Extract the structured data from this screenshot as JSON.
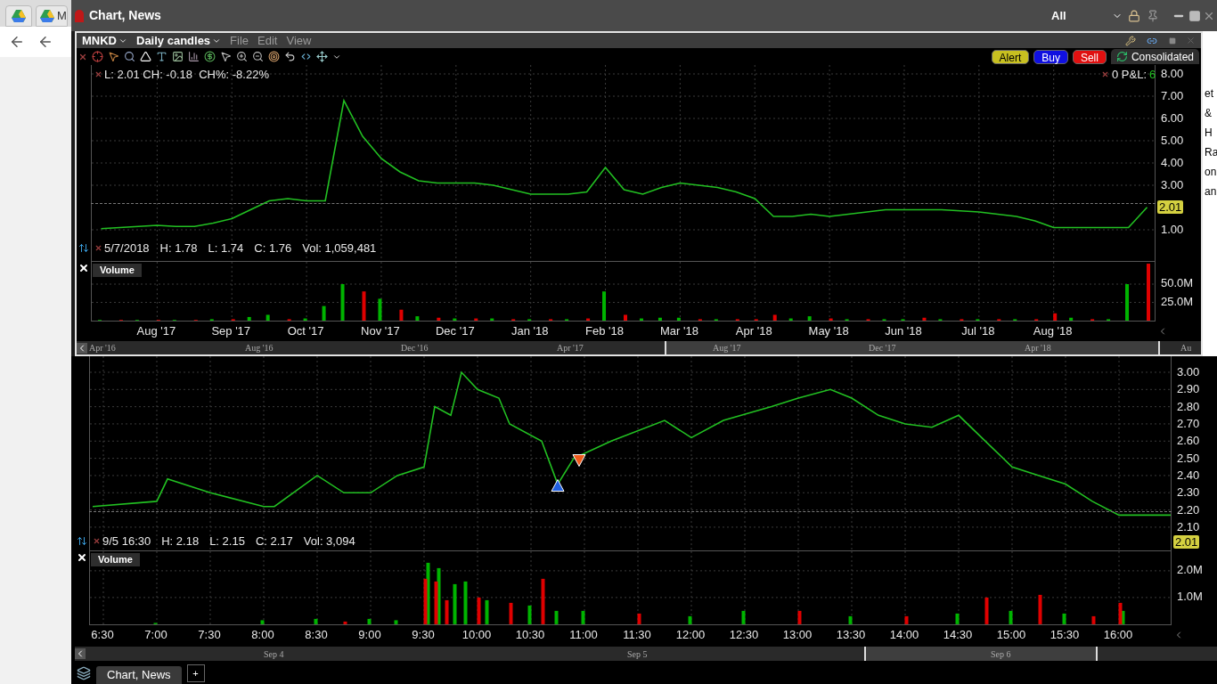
{
  "browser": {
    "tab_text": "M"
  },
  "window": {
    "title": "Chart, News",
    "group_filter": "All"
  },
  "background_fragments": [
    "et",
    "&",
    "H",
    "Ra",
    "on",
    "an"
  ],
  "daily_chart": {
    "symbol": "MNKD",
    "period": "Daily candles",
    "menu": [
      "File",
      "Edit",
      "View"
    ],
    "buttons": [
      {
        "kind": "alert",
        "label": "Alert"
      },
      {
        "kind": "buy",
        "label": "Buy"
      },
      {
        "kind": "sell",
        "label": "Sell"
      }
    ],
    "data_source": "Consolidated",
    "quote": "L: 2.01 CH: -0.18  CH%: -8.22%",
    "position": {
      "label": "0 P&L:",
      "value": "6"
    },
    "bar_info": [
      "5/7/2018",
      "H: 1.78",
      "L: 1.74",
      "C: 1.76",
      "Vol: 1,059,481"
    ],
    "last_price": "2.01",
    "price_chart": {
      "chart_data": {
        "type": "line",
        "grid": true,
        "ylim": [
          -0.4,
          8.4
        ],
        "yticks": [
          {
            "value": 8,
            "label": "8.00"
          },
          {
            "value": 7,
            "label": "7.00"
          },
          {
            "value": 6,
            "label": "6.00"
          },
          {
            "value": 5,
            "label": "5.00"
          },
          {
            "value": 4,
            "label": "4.00"
          },
          {
            "value": 3,
            "label": "3.00"
          },
          {
            "value": 1,
            "label": "1.00"
          }
        ],
        "series": [
          {
            "color": "#22c022",
            "values": [
              1.05,
              1.1,
              1.15,
              1.2,
              1.15,
              1.15,
              1.3,
              1.5,
              1.9,
              2.3,
              2.4,
              2.3,
              2.3,
              6.8,
              5.2,
              4.2,
              3.6,
              3.2,
              3.1,
              3.1,
              3.1,
              3.0,
              2.8,
              2.6,
              2.6,
              2.6,
              2.7,
              3.8,
              2.8,
              2.6,
              2.9,
              3.1,
              3.0,
              2.9,
              2.7,
              2.4,
              1.6,
              1.6,
              1.7,
              1.6,
              1.7,
              1.8,
              1.9,
              1.9,
              1.9,
              1.9,
              1.85,
              1.8,
              1.7,
              1.6,
              1.4,
              1.1,
              1.1,
              1.1,
              1.1,
              1.1,
              2.01
            ]
          }
        ]
      }
    },
    "volume_label": "Volume",
    "volume_chart": {
      "chart_data": {
        "type": "bar",
        "stacked": false,
        "grid": true,
        "ylim": [
          -2.4,
          80.5
        ],
        "categories": [
          null,
          null,
          null,
          "Aug '17",
          null,
          null,
          null,
          "Sep '17",
          null,
          null,
          null,
          "Oct '17",
          null,
          null,
          null,
          "Nov '17",
          null,
          null,
          null,
          "Dec '17",
          null,
          null,
          null,
          "Jan '18",
          null,
          null,
          null,
          "Feb '18",
          null,
          null,
          null,
          "Mar '18",
          null,
          null,
          null,
          "Apr '18",
          null,
          null,
          null,
          "May '18",
          null,
          null,
          null,
          "Jun '18",
          null,
          null,
          null,
          "Jul '18",
          null,
          null,
          null,
          "Aug '18",
          null,
          null,
          null,
          null,
          null
        ],
        "yticks": [
          {
            "value": 50,
            "label": "50.0M"
          },
          {
            "value": 25,
            "label": "25.0M"
          }
        ],
        "series": [
          {
            "color": "#00b400",
            "values": [
              1,
              0,
              1,
              0,
              1,
              0,
              2,
              0,
              5,
              8,
              0,
              3,
              20,
              50,
              0,
              30,
              0,
              6,
              0,
              3,
              0,
              3,
              0,
              2,
              0,
              2,
              0,
              40,
              0,
              3,
              4,
              4,
              0,
              2,
              0,
              0,
              0,
              3,
              6,
              0,
              2,
              0,
              2,
              2,
              0,
              2,
              0,
              2,
              0,
              2,
              0,
              0,
              4,
              0,
              2,
              50,
              0
            ]
          },
          {
            "color": "#e00000",
            "values": [
              0,
              1,
              0,
              1,
              0,
              1,
              0,
              2,
              0,
              0,
              2,
              0,
              0,
              0,
              40,
              0,
              15,
              0,
              4,
              0,
              3,
              0,
              2,
              0,
              2,
              0,
              3,
              0,
              8,
              0,
              0,
              0,
              2,
              0,
              2,
              2,
              8,
              0,
              0,
              3,
              0,
              2,
              0,
              0,
              4,
              0,
              2,
              0,
              2,
              0,
              2,
              10,
              0,
              2,
              0,
              0,
              78
            ]
          }
        ]
      }
    },
    "navigator_labels": [
      "Apr '16",
      "Aug '16",
      "Dec '16",
      "Apr '17",
      "Aug '17",
      "Dec '17",
      "Apr '18",
      "Au"
    ]
  },
  "intraday_chart": {
    "bar_info": [
      "9/5 16:30",
      "H: 2.18",
      "L: 2.15",
      "C: 2.17",
      "Vol: 3,094"
    ],
    "last_price": "2.01",
    "trade_markers": [
      {
        "kind": "buy"
      },
      {
        "kind": "sell"
      }
    ],
    "price_chart": {
      "chart_data": {
        "type": "line",
        "grid": true,
        "xlim": [
          6.375,
          16.5
        ],
        "ylim": [
          1.965,
          3.093
        ],
        "yticks": [
          {
            "value": 3,
            "label": "3.00"
          },
          {
            "value": 2.9,
            "label": "2.90"
          },
          {
            "value": 2.8,
            "label": "2.80"
          },
          {
            "value": 2.7,
            "label": "2.70"
          },
          {
            "value": 2.6,
            "label": "2.60"
          },
          {
            "value": 2.5,
            "label": "2.50"
          },
          {
            "value": 2.4,
            "label": "2.40"
          },
          {
            "value": 2.3,
            "label": "2.30"
          },
          {
            "value": 2.2,
            "label": "2.20"
          },
          {
            "value": 2.1,
            "label": "2.10"
          }
        ],
        "x": [
          6.4,
          7.0,
          7.1,
          7.5,
          8.0,
          8.1,
          8.5,
          8.75,
          9.0,
          9.25,
          9.5,
          9.6,
          9.75,
          9.85,
          10.0,
          10.2,
          10.3,
          10.6,
          10.75,
          10.9,
          11.25,
          11.75,
          12.0,
          12.3,
          12.75,
          13.0,
          13.3,
          13.5,
          13.75,
          14.0,
          14.25,
          14.5,
          14.75,
          15.0,
          15.25,
          15.5,
          15.75,
          16.0,
          16.5
        ],
        "series": [
          {
            "color": "#22c022",
            "values": [
              2.22,
              2.25,
              2.38,
              2.3,
              2.22,
              2.22,
              2.4,
              2.3,
              2.3,
              2.4,
              2.45,
              2.8,
              2.75,
              3.0,
              2.9,
              2.85,
              2.7,
              2.6,
              2.35,
              2.5,
              2.6,
              2.72,
              2.62,
              2.72,
              2.8,
              2.85,
              2.9,
              2.85,
              2.75,
              2.7,
              2.68,
              2.75,
              2.6,
              2.45,
              2.4,
              2.35,
              2.25,
              2.17,
              2.17
            ]
          }
        ]
      }
    },
    "volume_label": "Volume",
    "volume_chart": {
      "chart_data": {
        "type": "bar",
        "stacked": false,
        "grid": true,
        "xlim": [
          6.375,
          16.5
        ],
        "ylim": [
          -0.07,
          2.73
        ],
        "xticks": [
          {
            "value": 6.5,
            "label": "6:30"
          },
          {
            "value": 7,
            "label": "7:00"
          },
          {
            "value": 7.5,
            "label": "7:30"
          },
          {
            "value": 8,
            "label": "8:00"
          },
          {
            "value": 8.5,
            "label": "8:30"
          },
          {
            "value": 9,
            "label": "9:00"
          },
          {
            "value": 9.5,
            "label": "9:30"
          },
          {
            "value": 10,
            "label": "10:00"
          },
          {
            "value": 10.5,
            "label": "10:30"
          },
          {
            "value": 11,
            "label": "11:00"
          },
          {
            "value": 11.5,
            "label": "11:30"
          },
          {
            "value": 12,
            "label": "12:00"
          },
          {
            "value": 12.5,
            "label": "12:30"
          },
          {
            "value": 13,
            "label": "13:00"
          },
          {
            "value": 13.5,
            "label": "13:30"
          },
          {
            "value": 14,
            "label": "14:00"
          },
          {
            "value": 14.5,
            "label": "14:30"
          },
          {
            "value": 15,
            "label": "15:00"
          },
          {
            "value": 15.5,
            "label": "15:30"
          },
          {
            "value": 16,
            "label": "16:00"
          }
        ],
        "yticks": [
          {
            "value": 2,
            "label": "2.0M"
          },
          {
            "value": 1,
            "label": "1.0M"
          }
        ],
        "x": [
          7.0,
          8.0,
          8.5,
          8.75,
          9.0,
          9.25,
          9.5,
          9.55,
          9.6,
          9.65,
          9.7,
          9.8,
          9.9,
          10.0,
          10.1,
          10.3,
          10.5,
          10.6,
          10.75,
          11,
          11.5,
          12,
          12.5,
          13,
          13.5,
          14,
          14.5,
          14.75,
          15.0,
          15.25,
          15.5,
          15.75,
          16.0,
          16.05
        ],
        "series": [
          {
            "color": "#00b400",
            "values": [
              0.05,
              0.15,
              0.2,
              0,
              0.2,
              0.15,
              0,
              2.3,
              0,
              2.1,
              0,
              1.5,
              1.6,
              0,
              0.9,
              0,
              0.7,
              0,
              0.5,
              0.5,
              0,
              0.3,
              0.5,
              0,
              0.3,
              0,
              0.4,
              0,
              0.5,
              0,
              0.4,
              0,
              0,
              0.5
            ]
          },
          {
            "color": "#e00000",
            "values": [
              0,
              0,
              0,
              0.1,
              0,
              0,
              1.7,
              0,
              1.6,
              0,
              0.9,
              0,
              0,
              1.0,
              0,
              0.8,
              0,
              1.7,
              0,
              0,
              0.4,
              0,
              0,
              0.5,
              0,
              0.3,
              0,
              1.0,
              0,
              1.1,
              0,
              0.3,
              0.8,
              0
            ]
          }
        ]
      }
    },
    "navigator_labels": [
      "Sep 4",
      "Sep 5",
      "Sep 6"
    ]
  },
  "bottom_tabs": [
    {
      "label": "Chart, News",
      "selected": true
    }
  ],
  "add_tab": "+"
}
